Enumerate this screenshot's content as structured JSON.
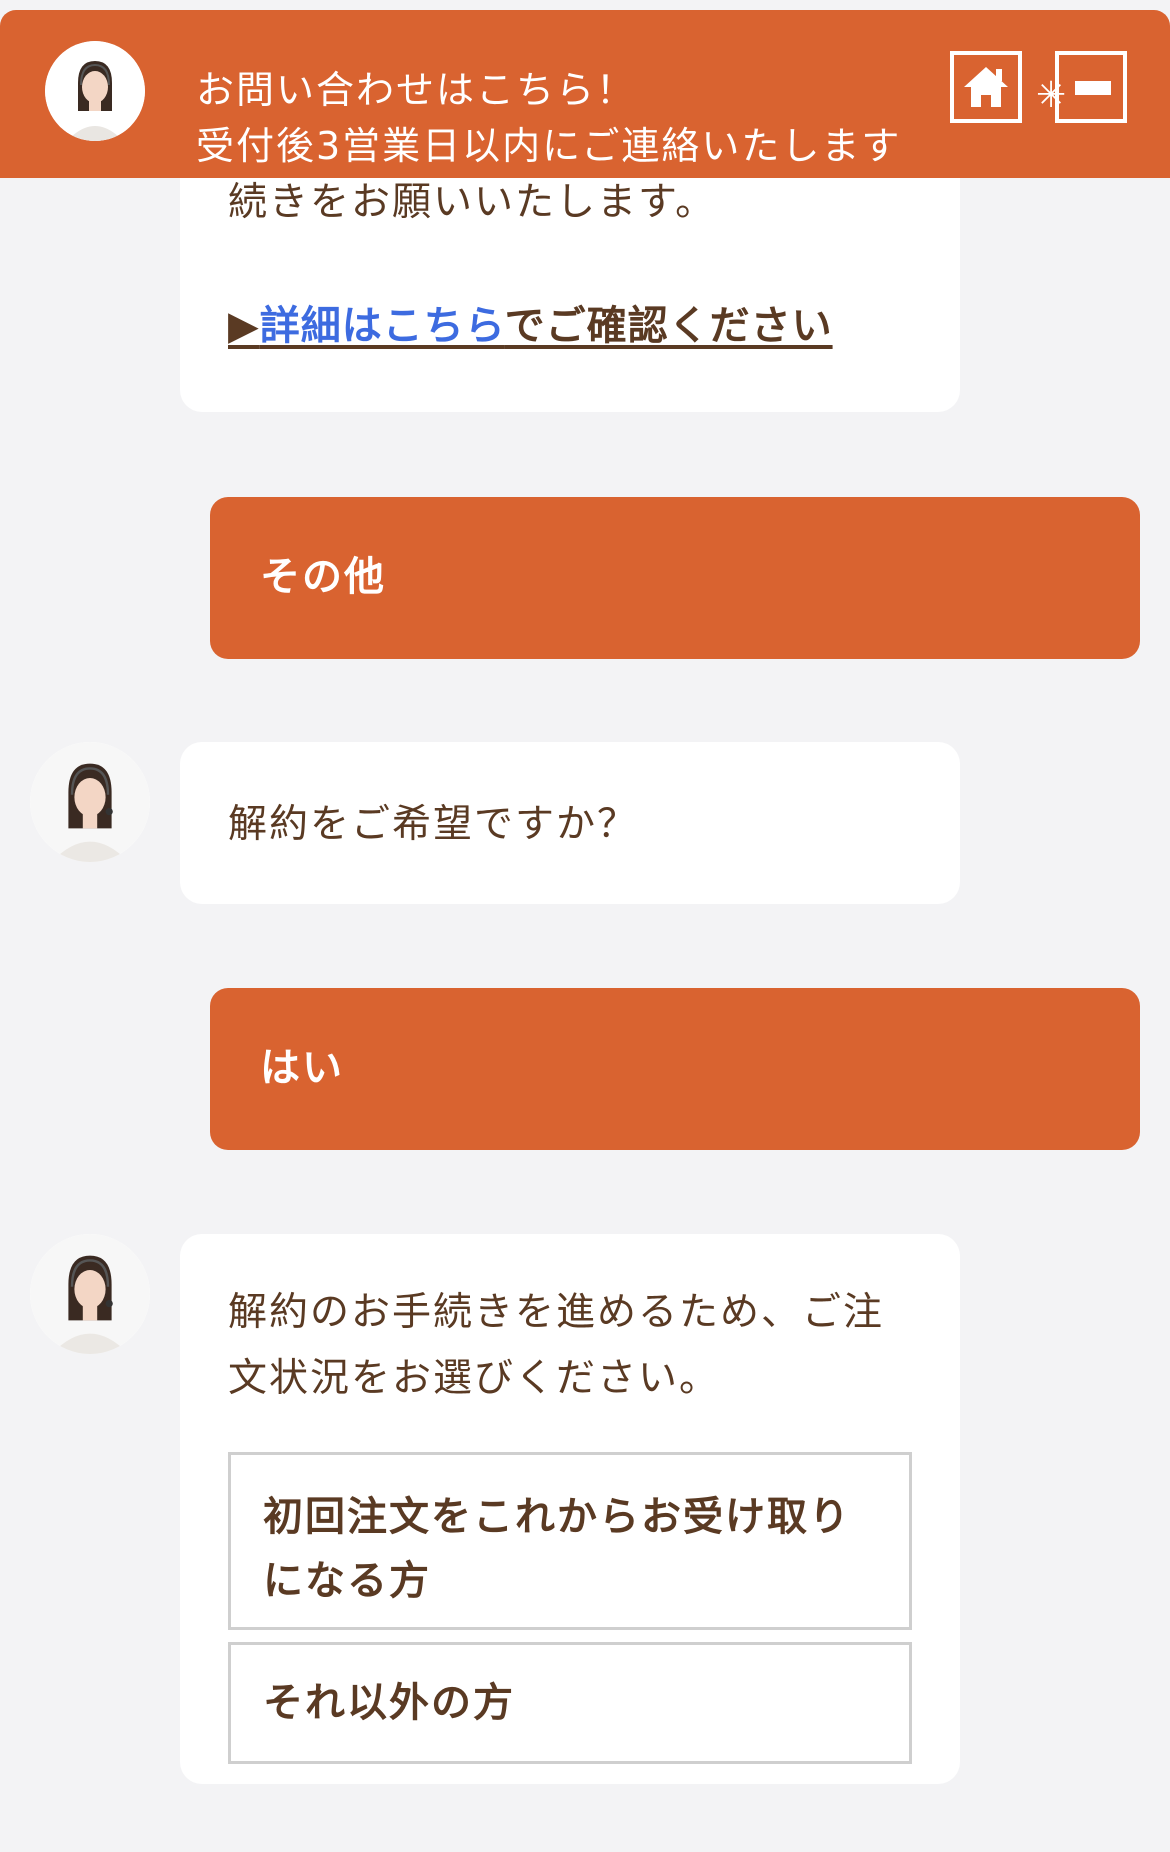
{
  "header": {
    "line1": "お問い合わせはこちら！",
    "line2": "受付後3営業日以内にご連絡いたします",
    "home_icon": "home-icon",
    "minimize_icon": "minimize-icon",
    "accent_color": "#d96330"
  },
  "messages": {
    "bot1": {
      "text": "続きをお願いいたします。",
      "link_prefix": "▶",
      "link_text": "詳細はこちら",
      "link_suffix": "でご確認ください"
    },
    "user1": "その他",
    "bot2": "解約をご希望ですか？",
    "user2": "はい",
    "bot3": {
      "text": "解約のお手続きを進めるため、ご注文状況をお選びください。",
      "option1": "初回注文をこれからお受け取りになる方",
      "option2": "それ以外の方"
    }
  }
}
